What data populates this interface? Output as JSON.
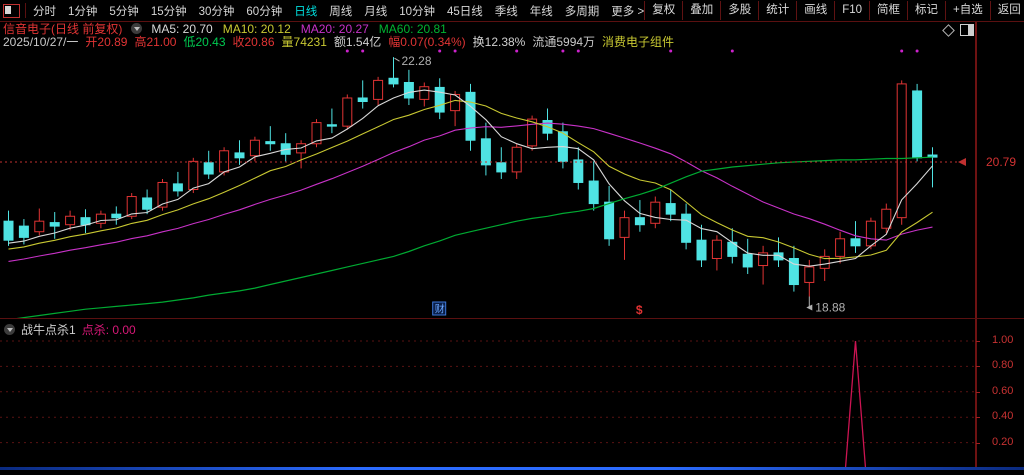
{
  "toolbar": {
    "periods": [
      "分时",
      "1分钟",
      "5分钟",
      "15分钟",
      "30分钟",
      "60分钟",
      "日线",
      "周线",
      "月线",
      "10分钟",
      "45日线",
      "季线",
      "年线",
      "多周期",
      "更多 >"
    ],
    "active_period": "日线",
    "right_buttons": [
      "复权",
      "叠加",
      "多股",
      "统计",
      "画线",
      "F10",
      "简框",
      "标记",
      "+自选",
      "返回"
    ]
  },
  "header": {
    "title": "信音电子(日线 前复权)",
    "ma_labels": [
      {
        "text": "MA5: 20.70",
        "color": "#d8d8d8"
      },
      {
        "text": "MA10: 20.12",
        "color": "#c8c832"
      },
      {
        "text": "MA20: 20.27",
        "color": "#c832c8"
      },
      {
        "text": "MA60: 20.81",
        "color": "#00b432"
      }
    ]
  },
  "quote": {
    "fields": [
      {
        "text": "2025/10/27/一",
        "color": "#c8c8c8"
      },
      {
        "text": "开20.89",
        "color": "#e13434"
      },
      {
        "text": "高21.00",
        "color": "#e13434"
      },
      {
        "text": "低20.43",
        "color": "#00c850"
      },
      {
        "text": "收20.86",
        "color": "#e13434"
      },
      {
        "text": "量74231",
        "color": "#c8c832"
      },
      {
        "text": "额1.54亿",
        "color": "#d0d0d0"
      },
      {
        "text": "幅0.07(0.34%)",
        "color": "#e13434"
      },
      {
        "text": "换12.38%",
        "color": "#d0d0d0"
      },
      {
        "text": "流通5994万",
        "color": "#c8c8c8"
      },
      {
        "text": "消费电子组件",
        "color": "#c8c832"
      }
    ]
  },
  "icons": {
    "window_layout": "◧",
    "collapse_main": "⌄",
    "collapse_sub": "⌄",
    "diamond": "◇",
    "split_panel": "◨"
  },
  "colors": {
    "up": "#e13434",
    "down": "#4fe3e3",
    "ma5": "#d8d8d8",
    "ma10": "#c8c832",
    "ma20": "#c832c8",
    "ma60": "#00aa32",
    "price_line": "#c03030",
    "annotation": "#b0b0b0",
    "top_dots": "#cc22cc",
    "sub_line": "#cc1452",
    "grid": "#5a1212",
    "marker_cai": "#6aa6ff",
    "marker_dollar": "#e03232"
  },
  "chart_data": {
    "type": "candlestick",
    "title": "信音电子 日线 前复权",
    "ylim": [
      18.8,
      22.45
    ],
    "annotations": {
      "high_label": "22.28",
      "low_label": "18.88",
      "price_label": "20.79",
      "price_value": 20.79
    },
    "high_index": 25,
    "low_index": 52,
    "candles": [
      [
        19.95,
        20.1,
        19.6,
        19.68
      ],
      [
        19.88,
        19.98,
        19.62,
        19.72
      ],
      [
        19.8,
        20.13,
        19.75,
        19.95
      ],
      [
        19.93,
        20.08,
        19.7,
        19.88
      ],
      [
        19.9,
        20.1,
        19.82,
        20.02
      ],
      [
        20.0,
        20.12,
        19.78,
        19.9
      ],
      [
        19.92,
        20.1,
        19.85,
        20.05
      ],
      [
        20.05,
        20.16,
        19.9,
        20.0
      ],
      [
        20.02,
        20.35,
        19.98,
        20.3
      ],
      [
        20.28,
        20.4,
        20.05,
        20.12
      ],
      [
        20.15,
        20.55,
        20.1,
        20.5
      ],
      [
        20.48,
        20.65,
        20.3,
        20.38
      ],
      [
        20.4,
        20.85,
        20.35,
        20.8
      ],
      [
        20.78,
        20.95,
        20.55,
        20.62
      ],
      [
        20.65,
        21.0,
        20.6,
        20.95
      ],
      [
        20.92,
        21.1,
        20.75,
        20.85
      ],
      [
        20.88,
        21.15,
        20.8,
        21.1
      ],
      [
        21.08,
        21.3,
        20.95,
        21.05
      ],
      [
        21.05,
        21.2,
        20.8,
        20.9
      ],
      [
        20.92,
        21.1,
        20.7,
        21.05
      ],
      [
        21.05,
        21.4,
        21.0,
        21.35
      ],
      [
        21.32,
        21.55,
        21.2,
        21.3
      ],
      [
        21.3,
        21.75,
        21.25,
        21.7
      ],
      [
        21.7,
        21.95,
        21.55,
        21.65
      ],
      [
        21.68,
        22.0,
        21.6,
        21.95
      ],
      [
        21.98,
        22.28,
        21.85,
        21.9
      ],
      [
        21.92,
        22.1,
        21.6,
        21.7
      ],
      [
        21.68,
        21.92,
        21.58,
        21.86
      ],
      [
        21.85,
        21.98,
        21.4,
        21.5
      ],
      [
        21.52,
        21.8,
        21.3,
        21.75
      ],
      [
        21.78,
        21.9,
        20.95,
        21.1
      ],
      [
        21.12,
        21.35,
        20.6,
        20.75
      ],
      [
        20.78,
        21.0,
        20.55,
        20.65
      ],
      [
        20.65,
        21.05,
        20.55,
        21.0
      ],
      [
        21.02,
        21.45,
        20.95,
        21.4
      ],
      [
        21.38,
        21.55,
        21.1,
        21.2
      ],
      [
        21.22,
        21.35,
        20.7,
        20.8
      ],
      [
        20.82,
        21.0,
        20.4,
        20.5
      ],
      [
        20.52,
        20.8,
        20.1,
        20.2
      ],
      [
        20.22,
        20.45,
        19.6,
        19.7
      ],
      [
        19.72,
        20.1,
        19.4,
        20.0
      ],
      [
        20.0,
        20.25,
        19.8,
        19.9
      ],
      [
        19.92,
        20.3,
        19.85,
        20.22
      ],
      [
        20.2,
        20.4,
        19.95,
        20.05
      ],
      [
        20.05,
        20.2,
        19.55,
        19.65
      ],
      [
        19.68,
        19.9,
        19.3,
        19.4
      ],
      [
        19.42,
        19.75,
        19.25,
        19.68
      ],
      [
        19.65,
        19.85,
        19.35,
        19.45
      ],
      [
        19.48,
        19.7,
        19.2,
        19.3
      ],
      [
        19.32,
        19.6,
        19.05,
        19.5
      ],
      [
        19.5,
        19.72,
        19.3,
        19.4
      ],
      [
        19.42,
        19.6,
        18.95,
        19.05
      ],
      [
        19.08,
        19.4,
        18.88,
        19.3
      ],
      [
        19.28,
        19.55,
        19.1,
        19.45
      ],
      [
        19.45,
        19.8,
        19.35,
        19.7
      ],
      [
        19.7,
        19.95,
        19.5,
        19.6
      ],
      [
        19.6,
        20.0,
        19.55,
        19.95
      ],
      [
        19.85,
        20.2,
        19.78,
        20.12
      ],
      [
        20.0,
        21.95,
        19.9,
        21.9
      ],
      [
        21.8,
        21.9,
        20.8,
        20.85
      ],
      [
        20.89,
        21.0,
        20.43,
        20.86
      ]
    ],
    "ma_windows": [
      5,
      10,
      20
    ],
    "ma_prehistory": {
      "start": 17.6,
      "count": 60
    },
    "ma60": [
      18.55,
      18.58,
      18.61,
      18.64,
      18.67,
      18.7,
      18.72,
      18.74,
      18.76,
      18.78,
      18.8,
      18.83,
      18.86,
      18.9,
      18.93,
      18.96,
      19.0,
      19.05,
      19.1,
      19.15,
      19.2,
      19.25,
      19.3,
      19.35,
      19.4,
      19.45,
      19.52,
      19.6,
      19.67,
      19.75,
      19.8,
      19.85,
      19.9,
      19.95,
      19.99,
      20.02,
      20.06,
      20.09,
      20.13,
      20.2,
      20.27,
      20.33,
      20.4,
      20.49,
      20.58,
      20.66,
      20.69,
      20.72,
      20.74,
      20.76,
      20.78,
      20.79,
      20.8,
      20.81,
      20.82,
      20.82,
      20.83,
      20.84,
      20.84,
      20.85,
      20.86
    ],
    "top_dot_indices": [
      22,
      23,
      28,
      29,
      33,
      36,
      37,
      43,
      47,
      58,
      59
    ],
    "event_markers": [
      {
        "label": "财",
        "index": 28,
        "color": "#6aa6ff",
        "boxed": true
      },
      {
        "label": "$",
        "index": 41,
        "color": "#e03232",
        "boxed": false
      }
    ],
    "sub": {
      "type": "line",
      "name": "战牛点杀1",
      "value_label": "点杀: 0.00",
      "ylim": [
        0,
        1.08
      ],
      "yticks": [
        "1.00",
        "0.80",
        "0.60",
        "0.40",
        "0.20"
      ],
      "ytick_values": [
        1.0,
        0.8,
        0.6,
        0.4,
        0.2
      ],
      "base_value": 0.0,
      "spike_index": 55,
      "spike_value": 1.0
    }
  },
  "sub_header": {
    "name": "战牛点杀1",
    "value": "点杀: 0.00"
  }
}
